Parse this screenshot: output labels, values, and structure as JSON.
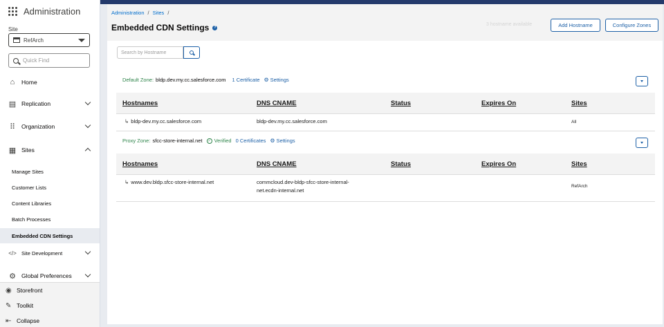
{
  "app": {
    "title": "Administration"
  },
  "site": {
    "label": "Site",
    "selected": "RefArch"
  },
  "quick_find": {
    "placeholder": "Quick Find"
  },
  "nav": {
    "home": "Home",
    "replication": "Replication",
    "organization": "Organization",
    "sites": "Sites",
    "sites_items": [
      "Manage Sites",
      "Customer Lists",
      "Content Libraries",
      "Batch Processes",
      "Embedded CDN Settings"
    ],
    "site_development": "Site Development",
    "global_preferences": "Global Preferences"
  },
  "bottom": {
    "storefront": "Storefront",
    "toolkit": "Toolkit",
    "collapse": "Collapse"
  },
  "header": {
    "breadcrumbs": [
      "Administration",
      "Sites"
    ],
    "title": "Embedded CDN Settings",
    "faint_text": "3 hostname available",
    "add_hostname": "Add Hostname",
    "configure_zones": "Configure Zones"
  },
  "search": {
    "placeholder": "Search by Hostname"
  },
  "zones": [
    {
      "label": "Default Zone:",
      "name": "bldp.dev.my.cc.salesforce.com",
      "certificates": "1 Certificate",
      "settings": "Settings",
      "verified": "",
      "columns": [
        "Hostnames",
        "DNS CNAME",
        "Status",
        "Expires On",
        "Sites"
      ],
      "rows": [
        {
          "hostname": "bldp-dev.my.cc.salesforce.com",
          "cname": "bldp-dev.my.cc.salesforce.com",
          "status": "",
          "expires": "",
          "sites": "All"
        }
      ]
    },
    {
      "label": "Proxy Zone:",
      "name": "sfcc-store-internal.net",
      "certificates": "0 Certificates",
      "settings": "Settings",
      "verified": "Verified",
      "columns": [
        "Hostnames",
        "DNS CNAME",
        "Status",
        "Expires On",
        "Sites"
      ],
      "rows": [
        {
          "hostname": "www.dev.bldp.sfcc-store-internal.net",
          "cname_line1": "commcloud.dev-bldp-sfcc-store-internal-",
          "cname_line2": "net.ecdn-internal.net",
          "status": "",
          "expires": "",
          "sites": "RefArch"
        }
      ]
    }
  ],
  "colors": {
    "accent": "#1b5fa6",
    "top_strip": "#243a6b",
    "green": "#2e844a"
  }
}
